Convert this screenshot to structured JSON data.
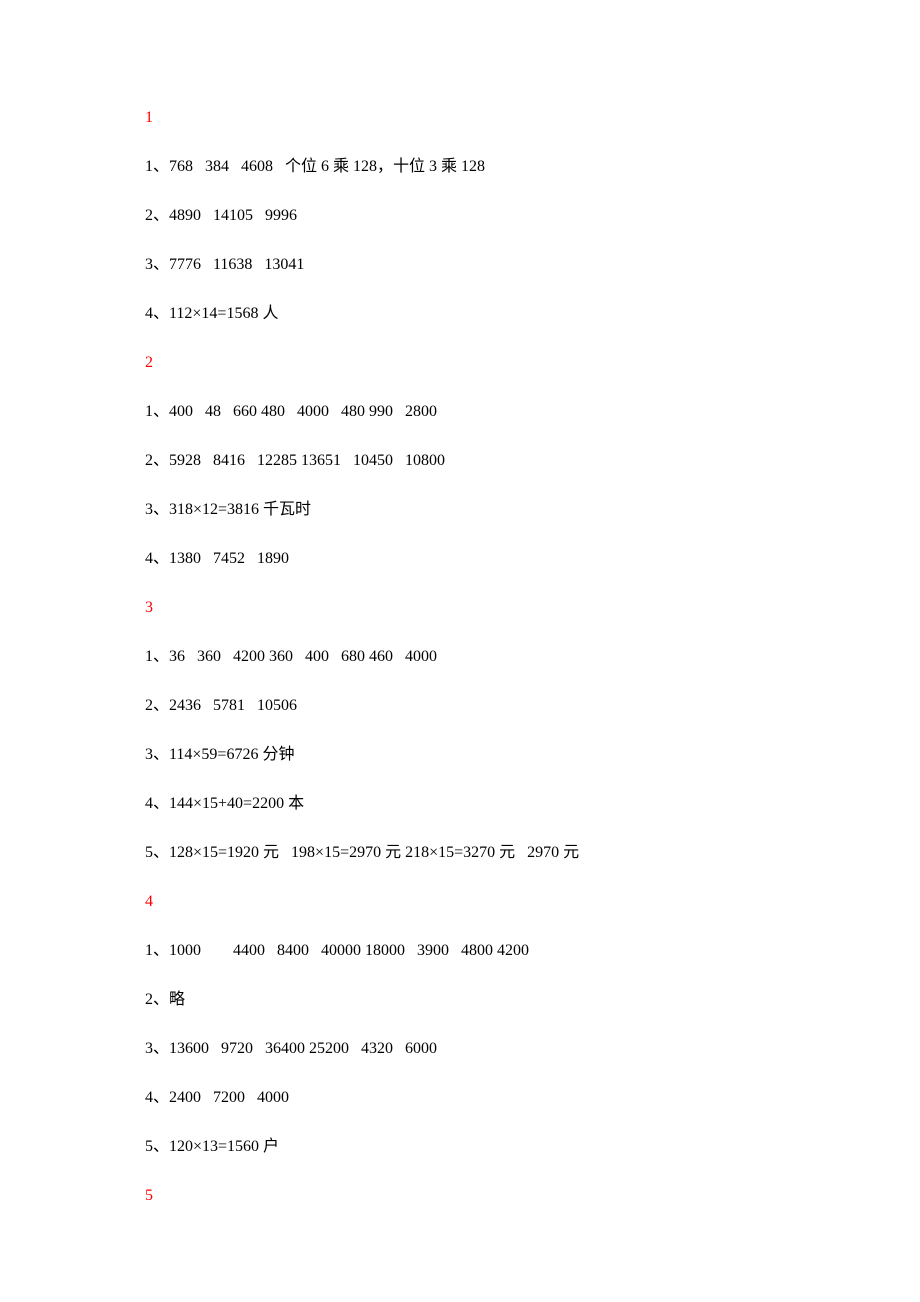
{
  "sections": [
    {
      "header": "1",
      "lines": [
        "1、768   384   4608   个位 6 乘 128，十位 3 乘 128",
        "2、4890   14105   9996",
        "3、7776   11638   13041",
        "4、112×14=1568 人"
      ]
    },
    {
      "header": "2",
      "lines": [
        "1、400   48   660 480   4000   480 990   2800",
        "2、5928   8416   12285 13651   10450   10800",
        "3、318×12=3816 千瓦时",
        "4、1380   7452   1890"
      ]
    },
    {
      "header": "3",
      "lines": [
        "1、36   360   4200 360   400   680 460   4000",
        "2、2436   5781   10506",
        "3、114×59=6726 分钟",
        "4、144×15+40=2200 本",
        "5、128×15=1920 元   198×15=2970 元 218×15=3270 元   2970 元"
      ]
    },
    {
      "header": "4",
      "lines": [
        "",
        "1、1000        4400   8400   40000 18000   3900   4800 4200",
        "2、略",
        "3、13600   9720   36400 25200   4320   6000",
        "4、2400   7200   4000",
        "5、120×13=1560 户"
      ]
    },
    {
      "header": "5",
      "lines": []
    }
  ]
}
